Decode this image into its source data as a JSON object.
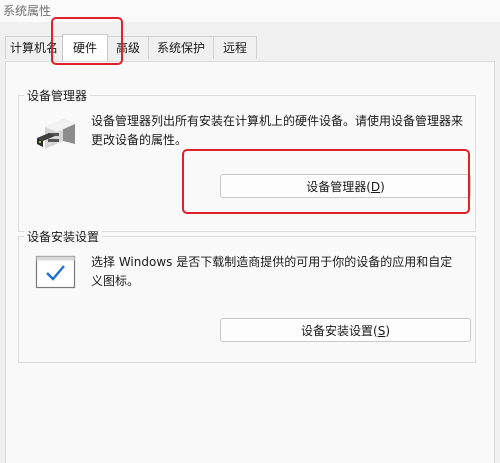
{
  "window": {
    "title": "系统属性"
  },
  "tabs": [
    {
      "label": "计算机名"
    },
    {
      "label": "硬件"
    },
    {
      "label": "高级"
    },
    {
      "label": "系统保护"
    },
    {
      "label": "远程"
    }
  ],
  "active_tab": "硬件",
  "device_manager": {
    "title": "设备管理器",
    "description": "设备管理器列出所有安装在计算机上的硬件设备。请使用设备管理器来更改设备的属性。",
    "button": {
      "label": "设备管理器(",
      "mnemonic": "D",
      "suffix": ")"
    }
  },
  "device_install": {
    "title": "设备安装设置",
    "description": "选择 Windows 是否下载制造商提供的可用于你的设备的应用和自定义图标。",
    "button": {
      "label": "设备安装设置(",
      "mnemonic": "S",
      "suffix": ")"
    }
  },
  "colors": {
    "highlight": "#e0202a",
    "check": "#1e6fd9"
  }
}
